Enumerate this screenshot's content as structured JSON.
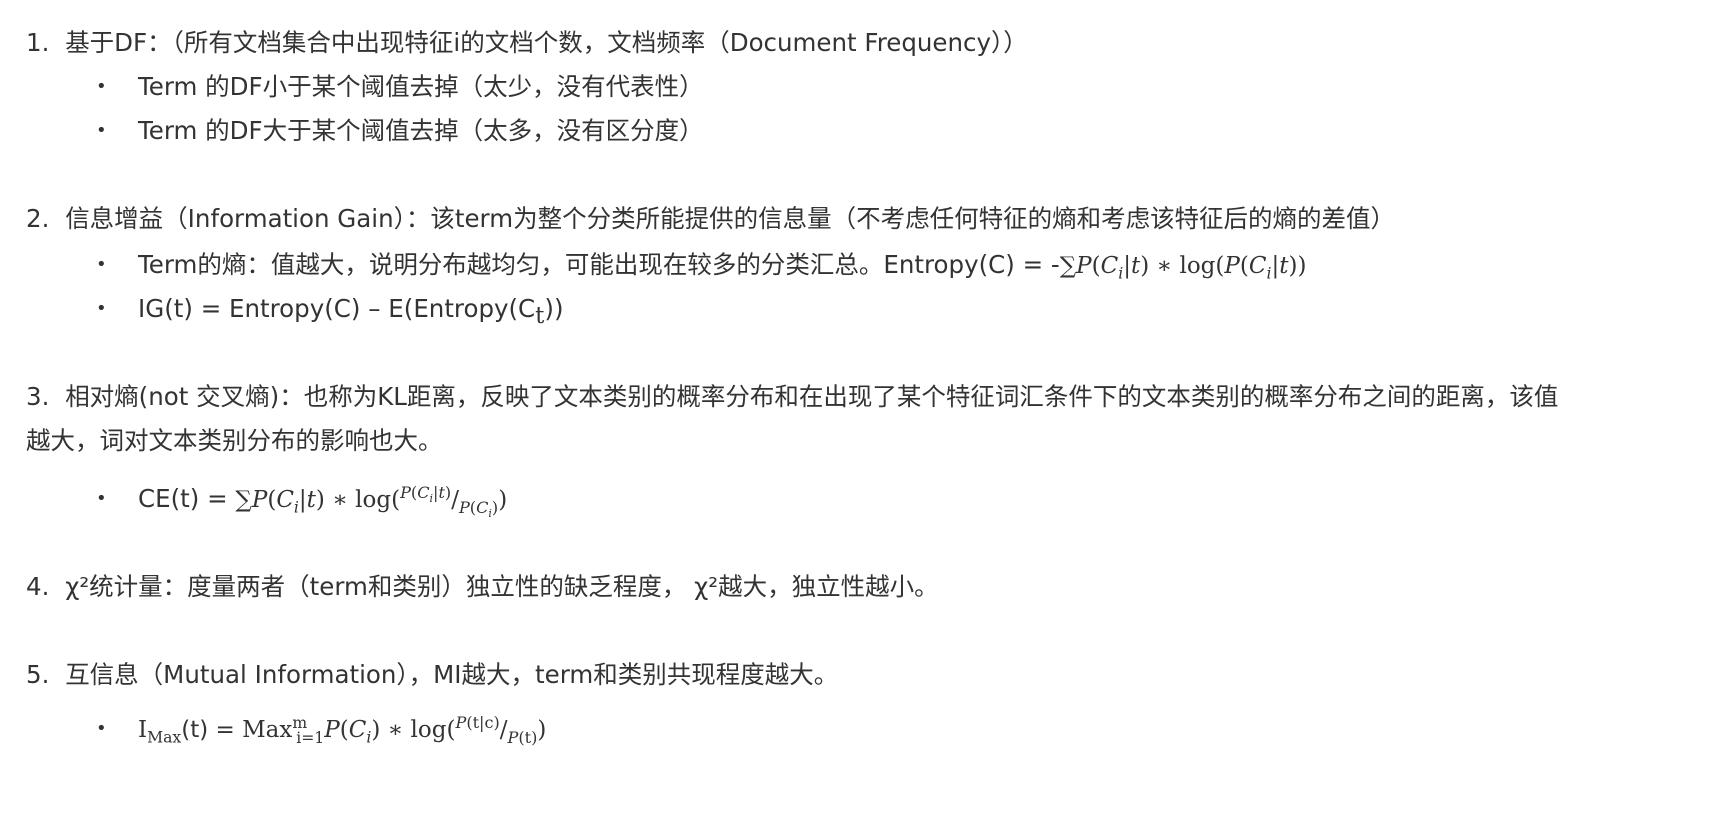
{
  "items": [
    {
      "number": "1.",
      "text": "基于DF：（所有文档集合中出现特征i的文档个数，文档频率（Document Frequency））",
      "bullets": [
        "Term 的DF小于某个阈值去掉（太少，没有代表性）",
        "Term 的DF大于某个阈值去掉（太多，没有区分度）"
      ]
    },
    {
      "number": "2.",
      "text": "信息增益（Information Gain）：该term为整个分类所能提供的信息量（不考虑任何特征的熵和考虑该特征后的熵的差值）",
      "bullets": [
        "Term的熵：值越大，说明分布越均匀，可能出现在较多的分类汇总。Entropy(C) = -",
        "IG(t) = Entropy(C) – E(Entropy(C"
      ]
    },
    {
      "number": "3.",
      "text_line1": "相对熵(not 交叉熵)：也称为KL距离，反映了文本类别的概率分布和在出现了某个特征词汇条件下的文本类别的概率分布之间的距离，该值",
      "text_line2": "越大，词对文本类别分布的影响也大。",
      "bullets": [
        "CE(t) = "
      ]
    },
    {
      "number": "4.",
      "text": "χ²统计量：度量两者（term和类别）独立性的缺乏程度， χ²越大，独立性越小。"
    },
    {
      "number": "5.",
      "text": "互信息（Mutual Information），MI越大，term和类别共现程度越大。",
      "bullets": [
        "I"
      ]
    }
  ],
  "bullet_symbol": "•"
}
